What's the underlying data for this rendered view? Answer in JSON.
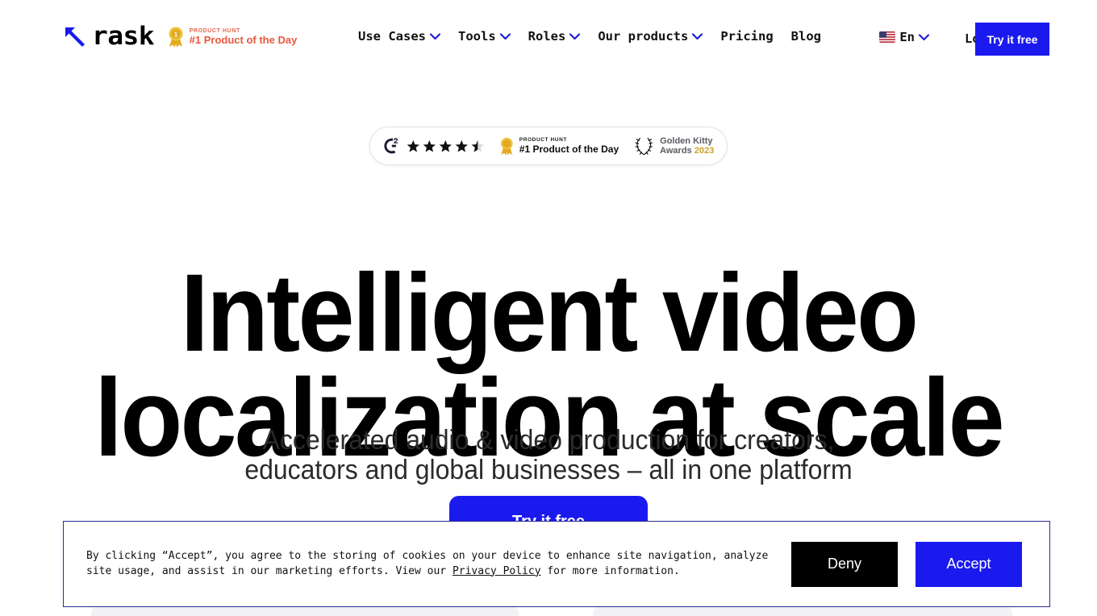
{
  "header": {
    "logo": {
      "word": "rask",
      "mark_icon": "arrow-up-left-icon"
    },
    "product_hunt_badge": {
      "kicker": "PRODUCT HUNT",
      "title": "#1 Product of the Day",
      "icon": "medal-icon",
      "color": "#e9573f"
    },
    "nav": [
      {
        "label": "Use Cases",
        "has_dropdown": true
      },
      {
        "label": "Tools",
        "has_dropdown": true
      },
      {
        "label": "Roles",
        "has_dropdown": true
      },
      {
        "label": "Our products",
        "has_dropdown": true
      },
      {
        "label": "Pricing",
        "has_dropdown": false
      },
      {
        "label": "Blog",
        "has_dropdown": false
      }
    ],
    "language": {
      "label": "En",
      "flag": "us-flag-icon"
    },
    "login_label": "Log in",
    "cta_label": "Try it free",
    "cta_color": "#1a1aee"
  },
  "badges": {
    "g2": {
      "name": "G2",
      "rating_stars": 4.5,
      "star_count": 5
    },
    "product_hunt": {
      "kicker": "PRODUCT HUNT",
      "title": "#1 Product of the Day"
    },
    "golden_kitty": {
      "line1": "Golden Kitty",
      "line2": "Awards",
      "year": "2023"
    }
  },
  "hero": {
    "title_line1": "Intelligent video",
    "title_line2": "localization at scale",
    "subtitle_line1": "Accelerated audio & video production for creators,",
    "subtitle_line2": "educators and global businesses – all in one platform",
    "cta_label": "Try it free"
  },
  "cookie_banner": {
    "text_before_link": "By clicking “Accept”, you agree to the storing of cookies on your device to enhance site navigation, analyze site usage, and assist in our marketing efforts. View our ",
    "link_label": "Privacy Policy",
    "text_after_link": " for more information.",
    "deny_label": "Deny",
    "accept_label": "Accept",
    "accept_color": "#1a1aee",
    "deny_color": "#000000",
    "border_color": "#2b2b8c"
  }
}
